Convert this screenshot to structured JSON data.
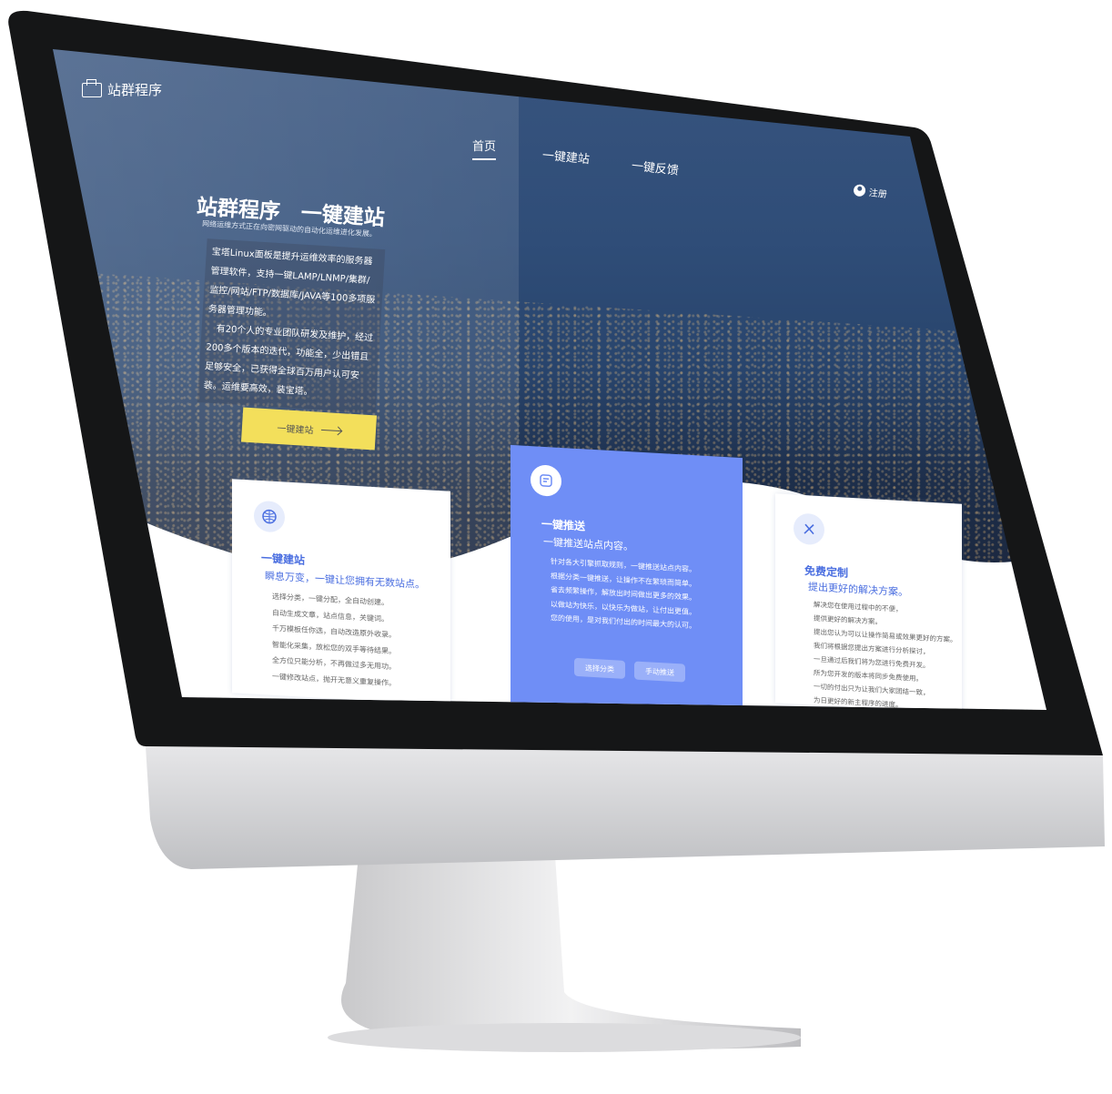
{
  "brand": {
    "name": "站群程序"
  },
  "nav": {
    "items": [
      {
        "label": "首页",
        "active": true
      },
      {
        "label": "一键建站",
        "active": false
      },
      {
        "label": "一键反馈",
        "active": false
      }
    ],
    "user_label": "注册"
  },
  "hero": {
    "title": "站群程序　一键建站",
    "subtitle": "网络运维方式正在向密网驱动的自动化运维进化发展。",
    "paragraph_1": "宝塔Linux面板是提升运维效率的服务器管理软件，支持一键LAMP/LNMP/集群/监控/网站/FTP/数据库/JAVA等100多项服务器管理功能。",
    "paragraph_2": "有20个人的专业团队研发及维护，经过200多个版本的迭代，功能全，少出错且足够安全，已获得全球百万用户认可安装。运维要高效，装宝塔。",
    "button_label": "一键建站"
  },
  "features": [
    {
      "title": "一键建站",
      "subtitle": "瞬息万变，一键让您拥有无数站点。",
      "lines": [
        "选择分类，一键分配，全自动创建。",
        "自动生成文章，站点信息，关键词。",
        "千万模板任你选，自动改造原外收录。",
        "智能化采集，放松您的双手等待结果。",
        "全方位只能分析，不再做过多无用功。",
        "一键修改站点，抛开无意义重复操作。"
      ],
      "icon": "globe-icon"
    },
    {
      "title": "一键推送",
      "subtitle": "一键推送站点内容。",
      "lines": [
        "针对各大引擎抓取规则，一键推送站点内容。",
        "根据分类一键推送，让操作不在繁琐而简单。",
        "省去频繁操作，解放出时间做出更多的效果。",
        "以做站为快乐，以快乐为做站，让付出更值。",
        "您的使用，是对我们付出的时间最大的认可。"
      ],
      "buttons": [
        "选择分类",
        "手动推送"
      ],
      "icon": "document-icon"
    },
    {
      "title": "免费定制",
      "subtitle": "提出更好的解决方案。",
      "lines": [
        "解决您在使用过程中的不便，",
        "提供更好的解决方案。",
        "提出您认为可以让操作简易或效果更好的方案。",
        "我们将根据您提出方案进行分析探讨，",
        "一旦通过后我们将为您进行免费开发。",
        "所为您开发的版本将同步免费使用。",
        "一切的付出只为让我们大家团结一致，",
        "为日更好的新主程序的进度。"
      ],
      "icon": "tools-icon"
    }
  ]
}
